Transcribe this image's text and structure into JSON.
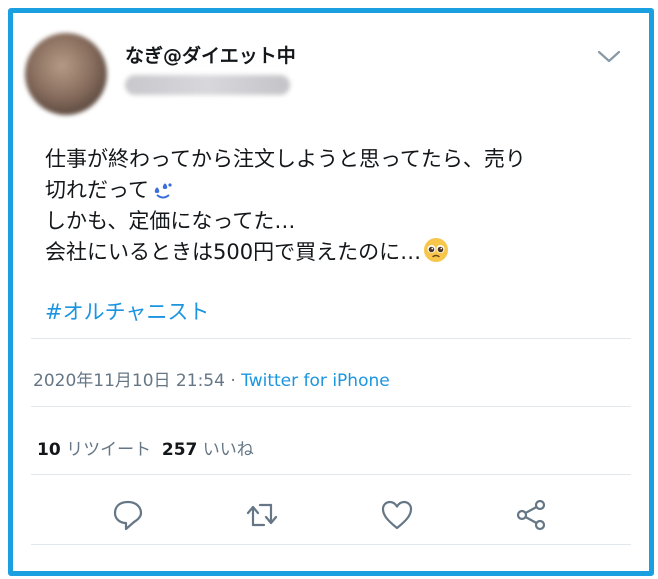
{
  "author": {
    "display_name": "なぎ@ダイエット中",
    "handle": ""
  },
  "tweet": {
    "lines": [
      "仕事が終わってから注文しようと思ってたら、売り",
      "切れだって",
      "しかも、定価になってた…",
      "会社にいるときは500円で買えたのに…"
    ],
    "emoji_after_line_2": "sweat-smile-emoji",
    "emoji_after_line_4": "pleading-face-emoji",
    "hashtag": "#オルチャニスト"
  },
  "meta": {
    "timestamp": "2020年11月10日 21:54",
    "separator": " · ",
    "source": "Twitter for iPhone"
  },
  "stats": {
    "retweets_count": "10",
    "retweets_label": "リツイート",
    "likes_count": "257",
    "likes_label": "いいね"
  },
  "actions": [
    "reply-icon",
    "retweet-icon",
    "like-icon",
    "share-icon"
  ],
  "colors": {
    "border": "#1a9fe0",
    "link": "#1b95e0",
    "text": "#14171a",
    "muted": "#657786",
    "icon": "#657786"
  }
}
